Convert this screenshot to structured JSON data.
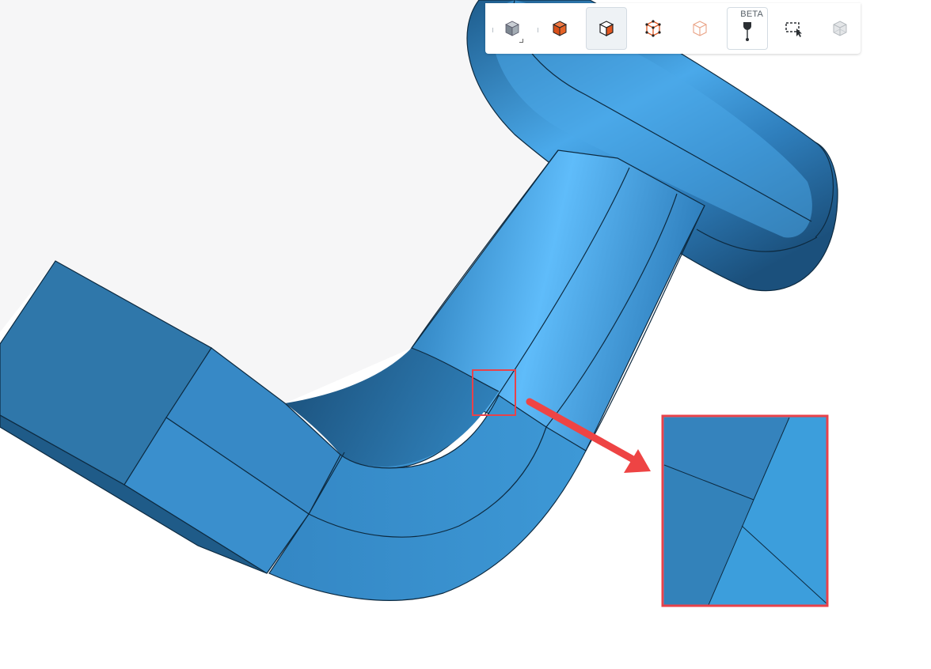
{
  "toolbar": {
    "buttons": [
      {
        "id": "view-cube",
        "icon": "cube-view-icon"
      },
      {
        "id": "select-volumes",
        "icon": "cube-volume-select-icon"
      },
      {
        "id": "select-faces",
        "icon": "cube-face-select-icon"
      },
      {
        "id": "select-edges",
        "icon": "cube-edge-select-icon"
      },
      {
        "id": "select-vertices",
        "icon": "cube-vertex-select-icon"
      },
      {
        "id": "point-probe",
        "icon": "pin-probe-icon",
        "badge": "BETA"
      },
      {
        "id": "box-select",
        "icon": "box-select-icon"
      },
      {
        "id": "show-hidden",
        "icon": "cube-hidden-icon"
      }
    ],
    "active_button": "select-faces"
  },
  "colors": {
    "model": "#3d8fcc",
    "highlight": "#e8424a",
    "background": "#f6f6f7",
    "accent": "#e2561f"
  }
}
